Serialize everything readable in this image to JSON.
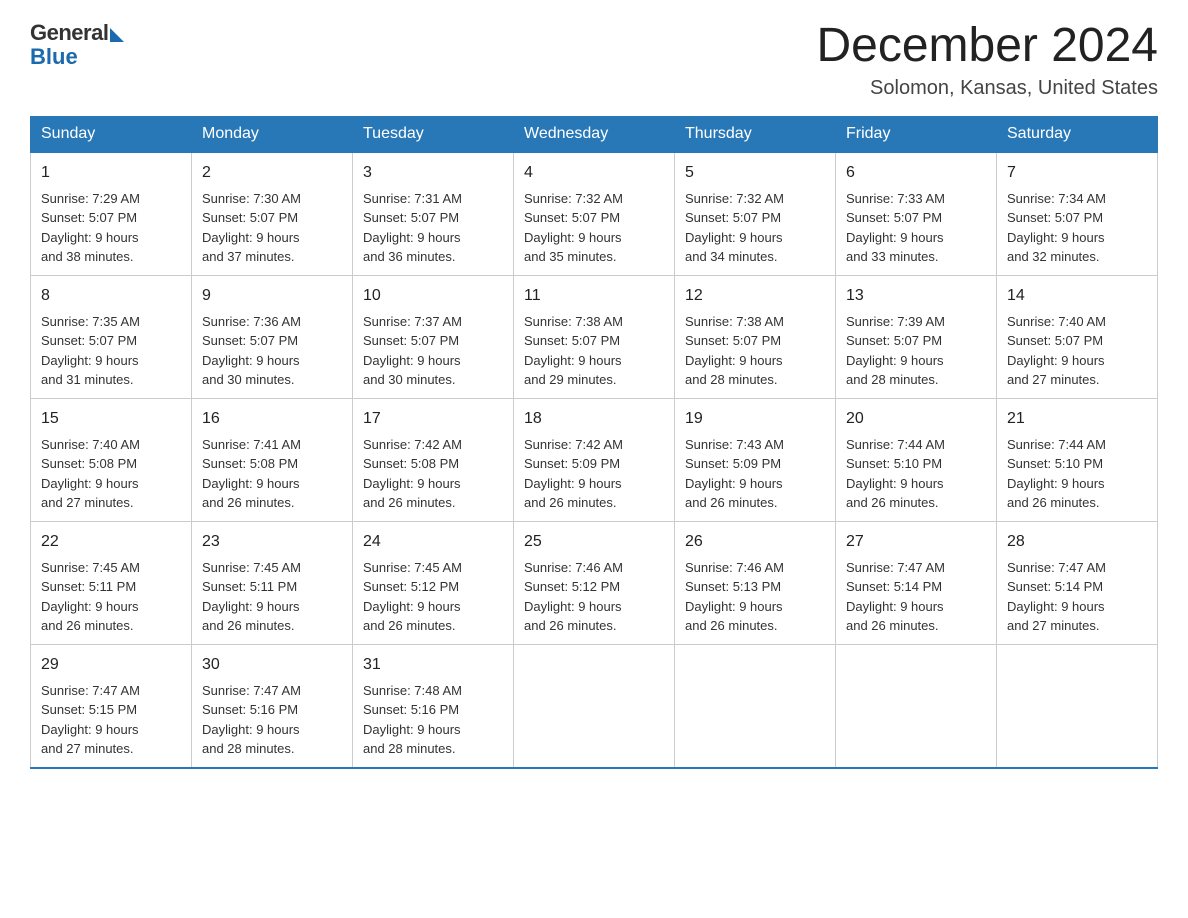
{
  "header": {
    "logo_general": "General",
    "logo_blue": "Blue",
    "month_title": "December 2024",
    "location": "Solomon, Kansas, United States"
  },
  "days_of_week": [
    "Sunday",
    "Monday",
    "Tuesday",
    "Wednesday",
    "Thursday",
    "Friday",
    "Saturday"
  ],
  "weeks": [
    [
      {
        "day": "1",
        "sunrise": "7:29 AM",
        "sunset": "5:07 PM",
        "daylight": "9 hours and 38 minutes."
      },
      {
        "day": "2",
        "sunrise": "7:30 AM",
        "sunset": "5:07 PM",
        "daylight": "9 hours and 37 minutes."
      },
      {
        "day": "3",
        "sunrise": "7:31 AM",
        "sunset": "5:07 PM",
        "daylight": "9 hours and 36 minutes."
      },
      {
        "day": "4",
        "sunrise": "7:32 AM",
        "sunset": "5:07 PM",
        "daylight": "9 hours and 35 minutes."
      },
      {
        "day": "5",
        "sunrise": "7:32 AM",
        "sunset": "5:07 PM",
        "daylight": "9 hours and 34 minutes."
      },
      {
        "day": "6",
        "sunrise": "7:33 AM",
        "sunset": "5:07 PM",
        "daylight": "9 hours and 33 minutes."
      },
      {
        "day": "7",
        "sunrise": "7:34 AM",
        "sunset": "5:07 PM",
        "daylight": "9 hours and 32 minutes."
      }
    ],
    [
      {
        "day": "8",
        "sunrise": "7:35 AM",
        "sunset": "5:07 PM",
        "daylight": "9 hours and 31 minutes."
      },
      {
        "day": "9",
        "sunrise": "7:36 AM",
        "sunset": "5:07 PM",
        "daylight": "9 hours and 30 minutes."
      },
      {
        "day": "10",
        "sunrise": "7:37 AM",
        "sunset": "5:07 PM",
        "daylight": "9 hours and 30 minutes."
      },
      {
        "day": "11",
        "sunrise": "7:38 AM",
        "sunset": "5:07 PM",
        "daylight": "9 hours and 29 minutes."
      },
      {
        "day": "12",
        "sunrise": "7:38 AM",
        "sunset": "5:07 PM",
        "daylight": "9 hours and 28 minutes."
      },
      {
        "day": "13",
        "sunrise": "7:39 AM",
        "sunset": "5:07 PM",
        "daylight": "9 hours and 28 minutes."
      },
      {
        "day": "14",
        "sunrise": "7:40 AM",
        "sunset": "5:07 PM",
        "daylight": "9 hours and 27 minutes."
      }
    ],
    [
      {
        "day": "15",
        "sunrise": "7:40 AM",
        "sunset": "5:08 PM",
        "daylight": "9 hours and 27 minutes."
      },
      {
        "day": "16",
        "sunrise": "7:41 AM",
        "sunset": "5:08 PM",
        "daylight": "9 hours and 26 minutes."
      },
      {
        "day": "17",
        "sunrise": "7:42 AM",
        "sunset": "5:08 PM",
        "daylight": "9 hours and 26 minutes."
      },
      {
        "day": "18",
        "sunrise": "7:42 AM",
        "sunset": "5:09 PM",
        "daylight": "9 hours and 26 minutes."
      },
      {
        "day": "19",
        "sunrise": "7:43 AM",
        "sunset": "5:09 PM",
        "daylight": "9 hours and 26 minutes."
      },
      {
        "day": "20",
        "sunrise": "7:44 AM",
        "sunset": "5:10 PM",
        "daylight": "9 hours and 26 minutes."
      },
      {
        "day": "21",
        "sunrise": "7:44 AM",
        "sunset": "5:10 PM",
        "daylight": "9 hours and 26 minutes."
      }
    ],
    [
      {
        "day": "22",
        "sunrise": "7:45 AM",
        "sunset": "5:11 PM",
        "daylight": "9 hours and 26 minutes."
      },
      {
        "day": "23",
        "sunrise": "7:45 AM",
        "sunset": "5:11 PM",
        "daylight": "9 hours and 26 minutes."
      },
      {
        "day": "24",
        "sunrise": "7:45 AM",
        "sunset": "5:12 PM",
        "daylight": "9 hours and 26 minutes."
      },
      {
        "day": "25",
        "sunrise": "7:46 AM",
        "sunset": "5:12 PM",
        "daylight": "9 hours and 26 minutes."
      },
      {
        "day": "26",
        "sunrise": "7:46 AM",
        "sunset": "5:13 PM",
        "daylight": "9 hours and 26 minutes."
      },
      {
        "day": "27",
        "sunrise": "7:47 AM",
        "sunset": "5:14 PM",
        "daylight": "9 hours and 26 minutes."
      },
      {
        "day": "28",
        "sunrise": "7:47 AM",
        "sunset": "5:14 PM",
        "daylight": "9 hours and 27 minutes."
      }
    ],
    [
      {
        "day": "29",
        "sunrise": "7:47 AM",
        "sunset": "5:15 PM",
        "daylight": "9 hours and 27 minutes."
      },
      {
        "day": "30",
        "sunrise": "7:47 AM",
        "sunset": "5:16 PM",
        "daylight": "9 hours and 28 minutes."
      },
      {
        "day": "31",
        "sunrise": "7:48 AM",
        "sunset": "5:16 PM",
        "daylight": "9 hours and 28 minutes."
      },
      null,
      null,
      null,
      null
    ]
  ],
  "labels": {
    "sunrise": "Sunrise:",
    "sunset": "Sunset:",
    "daylight": "Daylight:"
  }
}
